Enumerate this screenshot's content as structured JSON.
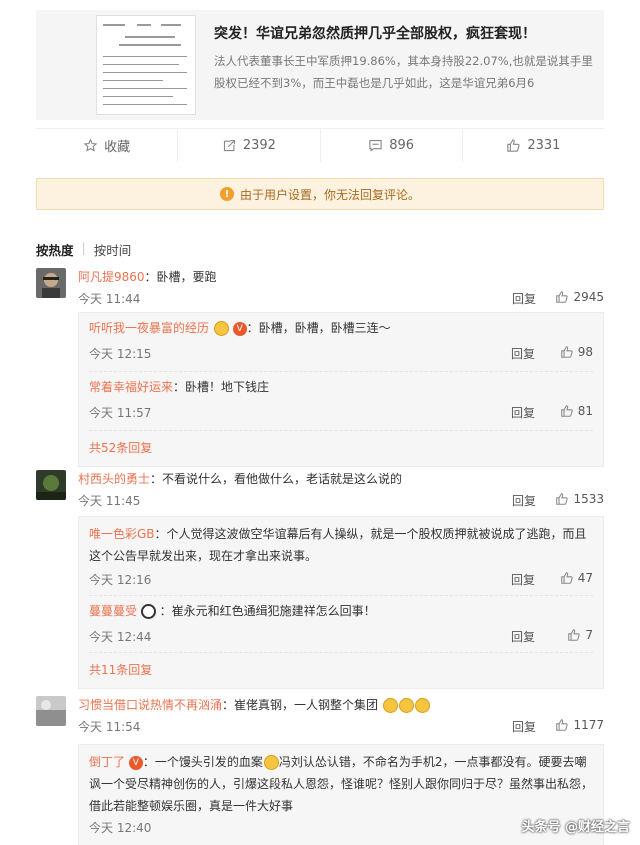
{
  "article": {
    "title": "突发！华谊兄弟忽然质押几乎全部股权，疯狂套现！",
    "desc": "法人代表董事长王中军质押19.86%，其本身持股22.07%,也就是说其手里股权已经不到3%，而王中磊也是几乎如此，这是华谊兄弟6月6"
  },
  "actions": {
    "favorite": "收藏",
    "repost": "2392",
    "comment": "896",
    "like": "2331"
  },
  "notice": "由于用户设置，你无法回复评论。",
  "sort": {
    "hot": "按热度",
    "time": "按时间"
  },
  "labels": {
    "reply": "回复"
  },
  "c1": {
    "user": "阿凡提9860",
    "text": "：卧槽，要跑",
    "time": "今天 11:44",
    "likes": "2945",
    "replies": [
      {
        "user": "听听我一夜暴富的经历",
        "text": "：卧槽，卧槽，卧槽三连～",
        "time": "今天 12:15",
        "likes": "98"
      },
      {
        "user": "常着幸福好运来",
        "text": "：卧槽！地下钱庄",
        "time": "今天 11:57",
        "likes": "81"
      }
    ],
    "more": "共52条回复"
  },
  "c2": {
    "user": "村西头的勇士",
    "text": "：不看说什么，看他做什么，老话就是这么说的",
    "time": "今天 11:45",
    "likes": "1533",
    "replies": [
      {
        "user": "唯一色彩GB",
        "text": "：个人觉得这波做空华谊幕后有人操纵，就是一个股权质押就被说成了逃跑，而且这个公告早就发出来，现在才拿出来说事。",
        "time": "今天 12:16",
        "likes": "47"
      },
      {
        "user": "蔓蔓蔓受",
        "text": "：崔永元和红色通缉犯施建祥怎么回事！",
        "time": "今天 12:44",
        "likes": "7"
      }
    ],
    "more": "共11条回复"
  },
  "c3": {
    "user": "习惯当借口说热情不再汹涌",
    "text": "：崔佬真钢，一人钢整个集团",
    "time": "今天 11:54",
    "likes": "1177",
    "replies": [
      {
        "user": "倒丁了",
        "text": "：一个馒头引发的血案",
        "text2": "冯刘认怂认错，不命名为手机2，一点事都没有。硬要去嘲讽一个受尽精神创伤的人，引爆这段私人恩怨，怪谁呢？怪别人跟你同归于尽？虽然事出私怨，借此若能整顿娱乐圈，真是一件大好事",
        "time": "今天 12:40"
      }
    ]
  },
  "watermark": "头条号 @财经之言",
  "colors": {
    "username": "#eb7350",
    "notice_bg": "#fdf2e0"
  }
}
